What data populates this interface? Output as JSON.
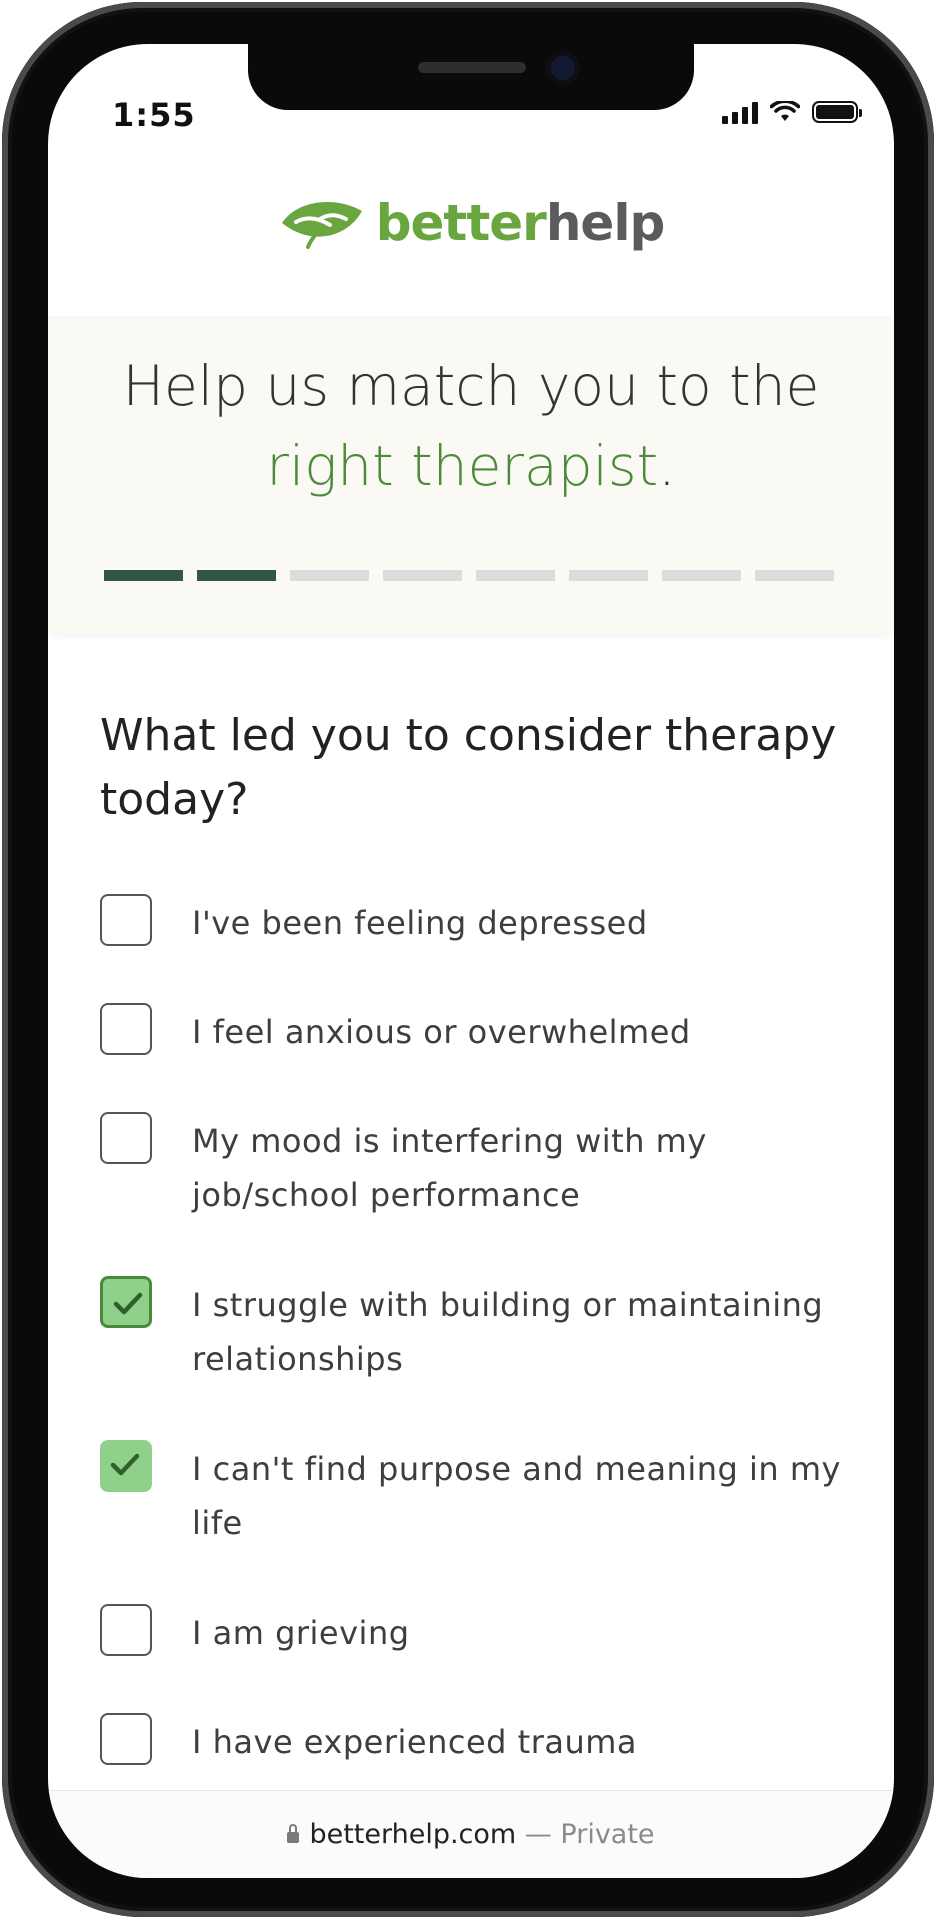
{
  "status_bar": {
    "time": "1:55"
  },
  "brand": {
    "name_green": "better",
    "name_gray": "help",
    "colors": {
      "green": "#6aa640",
      "gray": "#5b5b5b",
      "dark_green": "#2f5743"
    }
  },
  "banner": {
    "line1": "Help us match you to the",
    "line2_highlight": "right therapist",
    "line2_end": ".",
    "progress": {
      "total_steps": 8,
      "completed_steps": 2
    }
  },
  "question": "What led you to consider therapy today?",
  "options": [
    {
      "label": "I've been feeling depressed",
      "checked": false
    },
    {
      "label": "I feel anxious or overwhelmed",
      "checked": false
    },
    {
      "label": "My mood is interfering with my job/school performance",
      "checked": false
    },
    {
      "label": "I struggle with building or maintaining relationships",
      "checked": true
    },
    {
      "label": "I can't find purpose and meaning in my life",
      "checked": true
    },
    {
      "label": "I am grieving",
      "checked": false
    },
    {
      "label": "I have experienced trauma",
      "checked": false
    }
  ],
  "footer": {
    "domain": "betterhelp.com",
    "privacy": "— Private",
    "icon": "lock-icon"
  }
}
